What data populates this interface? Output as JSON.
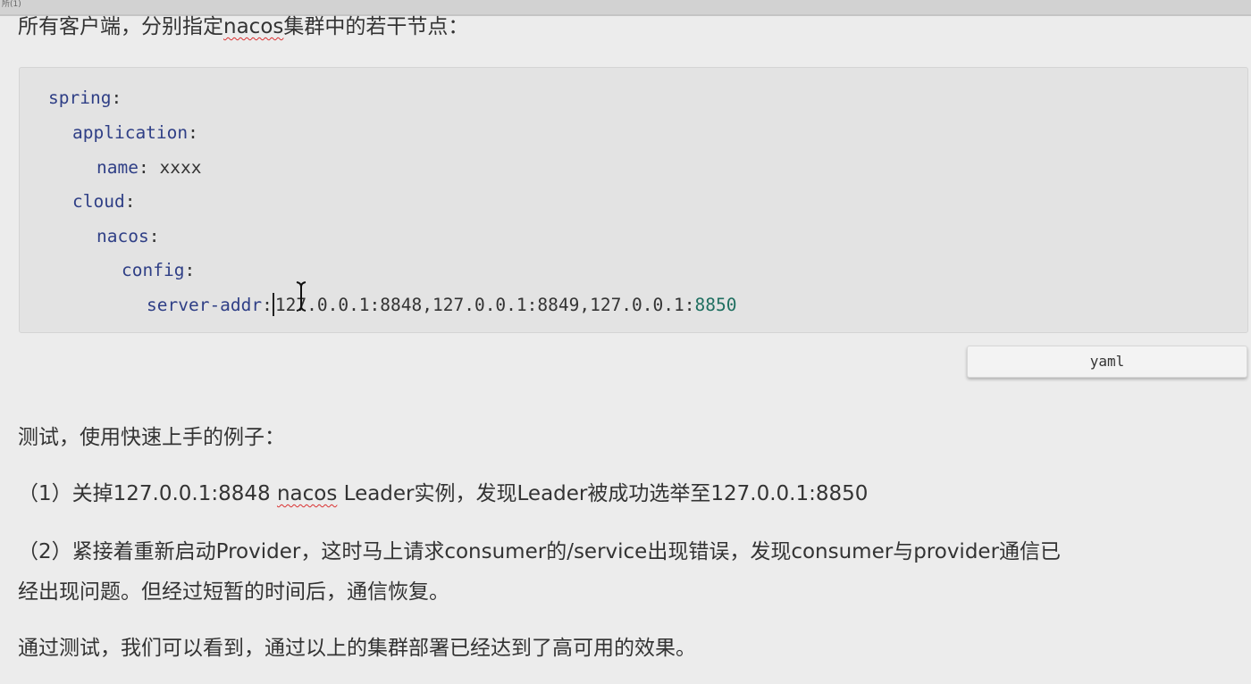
{
  "top_strip_text": "所(1)",
  "intro": {
    "before": "所有客户端，分别指定",
    "word": "nacos",
    "after": "集群中的若干节点："
  },
  "code": {
    "language_label": "yaml",
    "lines": [
      {
        "key": "spring",
        "sep": ":"
      },
      {
        "key": "application",
        "sep": ":"
      },
      {
        "key": "name",
        "sep": ":",
        "value": "xxxx"
      },
      {
        "key": "cloud",
        "sep": ":"
      },
      {
        "key": "nacos",
        "sep": ":"
      },
      {
        "key": "config",
        "sep": ":"
      },
      {
        "key": "server-addr",
        "sep": ":",
        "value_main": "127.0.0.1:8848,127.0.0.1:8849,127.0.0.1:",
        "value_tail": "8850"
      }
    ]
  },
  "body": {
    "test_heading": "测试，使用快速上手的例子：",
    "step1": {
      "before": "（1）关掉127.0.0.1:8848 ",
      "word": "nacos",
      "after": " Leader实例，发现Leader被成功选举至127.0.0.1:8850"
    },
    "step2_line1": "（2）紧接着重新启动Provider，这时马上请求consumer的/service出现错误，发现consumer与provider通信已",
    "step2_line2": "经出现问题。但经过短暂的时间后，通信恢复。",
    "conclusion": "通过测试，我们可以看到，通过以上的集群部署已经达到了高可用的效果。"
  },
  "colors": {
    "background": "#ececec",
    "code_background": "#e3e3e3",
    "code_key": "#2f3f86",
    "code_number": "#1f6f60",
    "spellcheck_underline": "#d93030"
  }
}
